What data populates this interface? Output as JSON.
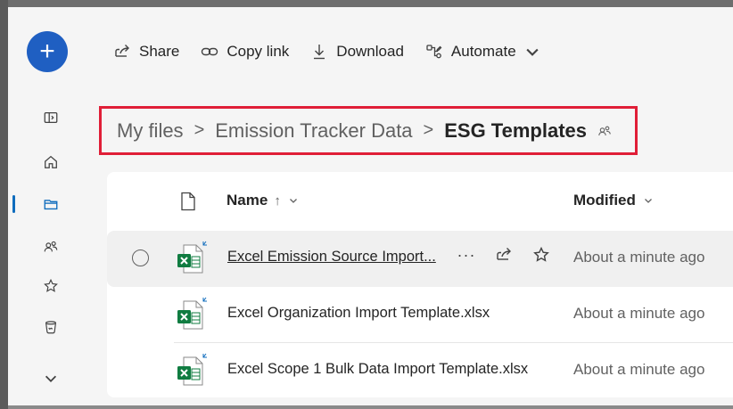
{
  "toolbar": {
    "share_label": "Share",
    "copy_link_label": "Copy link",
    "download_label": "Download",
    "automate_label": "Automate"
  },
  "breadcrumb": {
    "items": [
      "My files",
      "Emission Tracker Data",
      "ESG Templates"
    ],
    "separator": ">"
  },
  "columns": {
    "name_label": "Name",
    "name_sort": "↑",
    "modified_label": "Modified"
  },
  "files": [
    {
      "name": "Excel Emission Source Import...",
      "modified": "About a minute ago",
      "selected": true
    },
    {
      "name": "Excel Organization Import Template.xlsx",
      "modified": "About a minute ago",
      "selected": false
    },
    {
      "name": "Excel Scope 1 Bulk Data Import Template.xlsx",
      "modified": "About a minute ago",
      "selected": false
    }
  ],
  "row_actions": {
    "more": "···"
  },
  "fab": {
    "label": "+"
  },
  "colors": {
    "accent": "#0f6cbd",
    "fab": "#1f5fc2",
    "excel": "#107c41",
    "highlight_border": "#e01e37"
  }
}
